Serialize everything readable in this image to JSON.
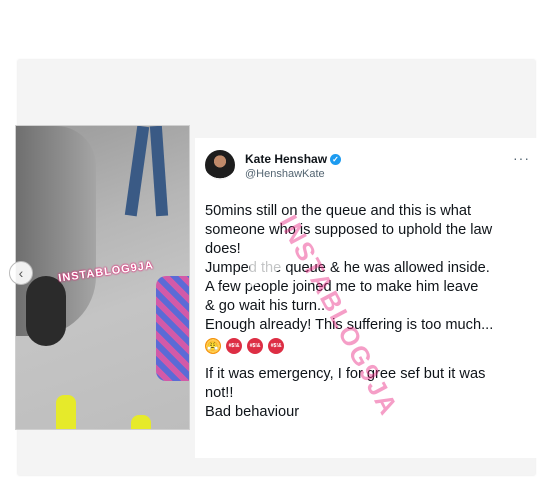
{
  "left_watermark": "INSTABLOG9JA",
  "overlay_watermark": "INSTABLOG9JA",
  "tweet": {
    "display_name": "Kate Henshaw",
    "handle": "@HenshawKate",
    "verified_icon": "✓",
    "more_icon": "···",
    "lines": [
      "50mins still on the queue and this is what",
      "someone who is supposed to uphold the law",
      "does!",
      "Jumped the queue & he was allowed inside.",
      "A few people joined me to make him leave",
      "& go wait his turn..",
      "Enough already! This suffering is too much..."
    ],
    "emoji_labels": [
      "😤",
      "#$!&",
      "#$!&",
      "#$!&"
    ],
    "lines2": [
      "If it was emergency, I for gree sef but it was",
      "not!!",
      "Bad behaviour"
    ]
  },
  "nav": {
    "prev_icon": "‹"
  },
  "colors": {
    "verified": "#1d9bf0",
    "watermark": "#e82882"
  }
}
